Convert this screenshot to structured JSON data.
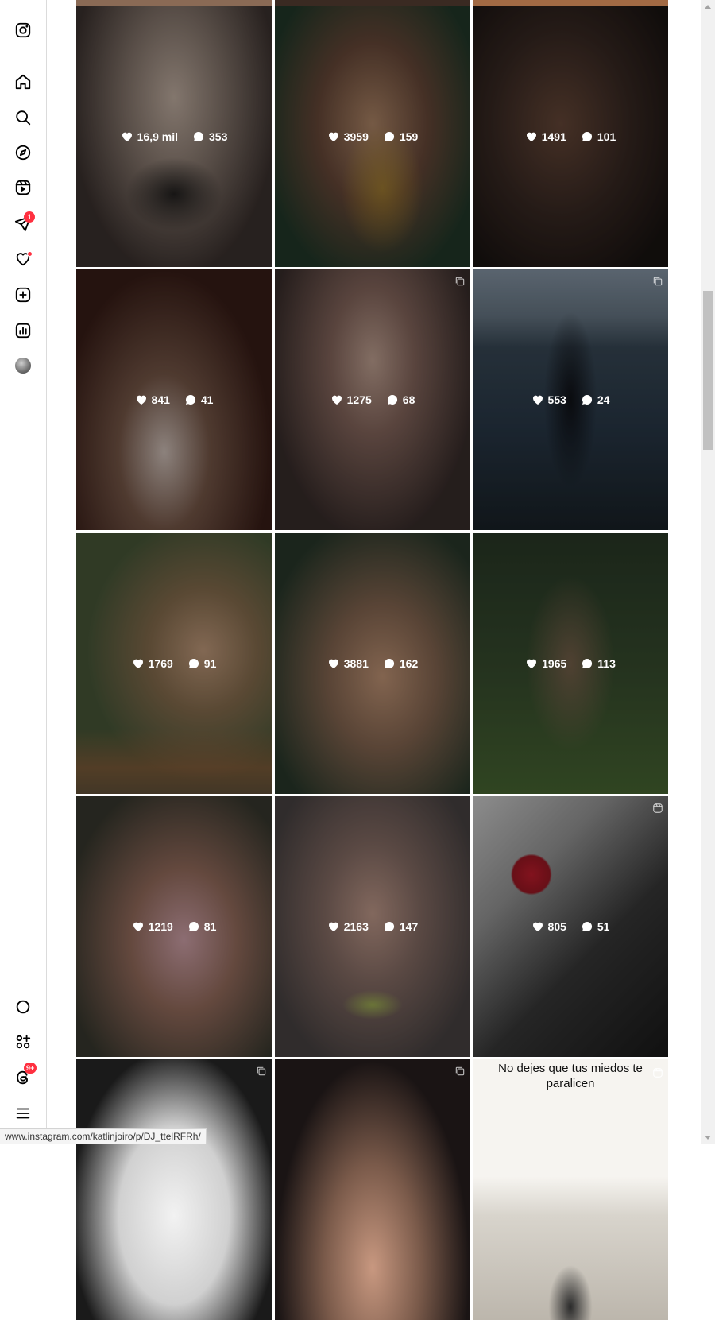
{
  "sidebar": {
    "items": [
      {
        "name": "instagram-logo-icon"
      },
      {
        "name": "home-icon"
      },
      {
        "name": "search-icon"
      },
      {
        "name": "explore-icon"
      },
      {
        "name": "reels-icon"
      },
      {
        "name": "messages-icon",
        "badge": "1"
      },
      {
        "name": "notifications-icon"
      },
      {
        "name": "create-icon"
      },
      {
        "name": "dashboard-icon"
      },
      {
        "name": "profile-avatar"
      }
    ],
    "bottom_items": [
      {
        "name": "meta-ai-icon"
      },
      {
        "name": "also-from-meta-icon"
      },
      {
        "name": "threads-icon",
        "badge": "9+"
      },
      {
        "name": "more-menu-icon"
      }
    ]
  },
  "posts": [
    {
      "likes": "16,9 mil",
      "comments": "353"
    },
    {
      "likes": "3959",
      "comments": "159"
    },
    {
      "likes": "1491",
      "comments": "101"
    },
    {
      "likes": "841",
      "comments": "41"
    },
    {
      "likes": "1275",
      "comments": "68"
    },
    {
      "likes": "553",
      "comments": "24"
    },
    {
      "likes": "1769",
      "comments": "91"
    },
    {
      "likes": "3881",
      "comments": "162"
    },
    {
      "likes": "1965",
      "comments": "113"
    },
    {
      "likes": "1219",
      "comments": "81"
    },
    {
      "likes": "2163",
      "comments": "147"
    },
    {
      "likes": "805",
      "comments": "51"
    }
  ],
  "partial_row": {
    "caption": "No dejes que tus miedos te paralicen"
  },
  "status_url": "www.instagram.com/katlinjoiro/p/DJ_ttelRFRh/"
}
